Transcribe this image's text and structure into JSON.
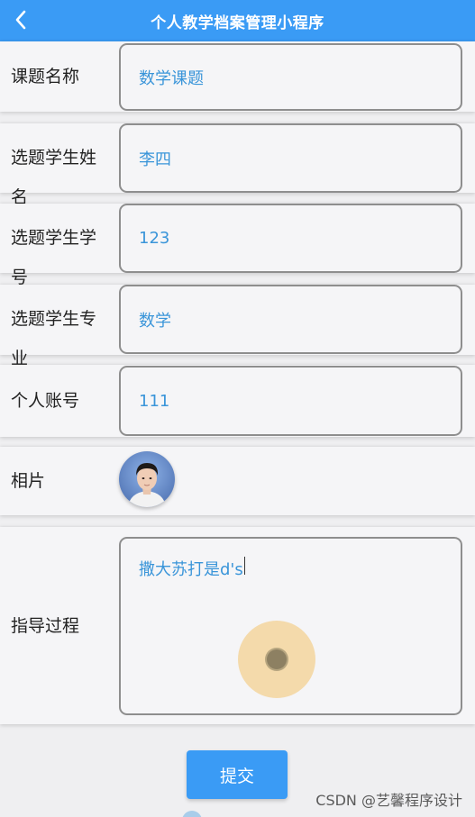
{
  "header": {
    "title": "个人教学档案管理小程序",
    "back_icon": "chevron-left-icon"
  },
  "form": {
    "fields": [
      {
        "label": "课题名称",
        "value": "数学课题"
      },
      {
        "label": "选题学生姓名",
        "value": "李四"
      },
      {
        "label": "选题学生学号",
        "value": "123"
      },
      {
        "label": "选题学生专业",
        "value": "数学"
      },
      {
        "label": "个人账号",
        "value": "111"
      }
    ],
    "photo": {
      "label": "相片"
    },
    "process": {
      "label": "指导过程",
      "value": "撒大苏打是d's"
    }
  },
  "submit_label": "提交",
  "watermark": "CSDN @艺馨程序设计",
  "colors": {
    "primary": "#3a9bf5",
    "value_text": "#3a95d9",
    "page_bg": "#efeff1"
  }
}
